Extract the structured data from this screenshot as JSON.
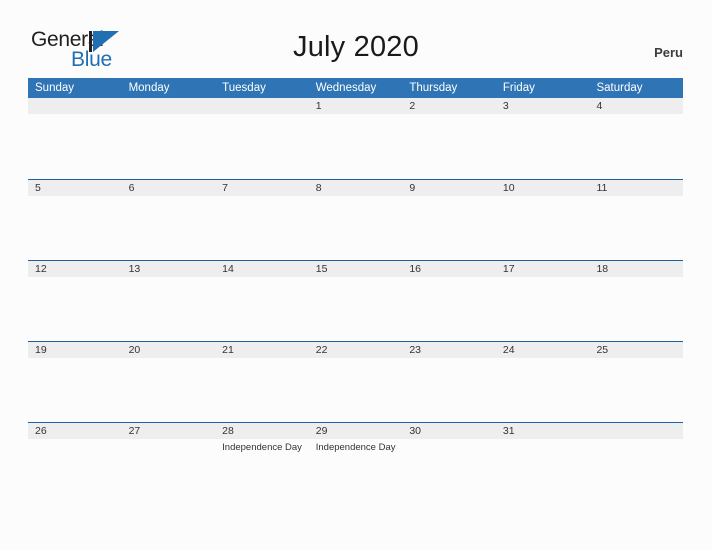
{
  "header": {
    "logo": {
      "word_one": "General",
      "word_two": "Blue",
      "mark_icon": "triangle-logo-icon"
    },
    "title": "July 2020",
    "locale": "Peru"
  },
  "calendar": {
    "weekdays": [
      "Sunday",
      "Monday",
      "Tuesday",
      "Wednesday",
      "Thursday",
      "Friday",
      "Saturday"
    ],
    "colors": {
      "header_blue": "#2f74b5",
      "separator_blue": "#1f5fa0",
      "date_band_gray": "#eeeeee",
      "page_background": "#fcfcfc",
      "brand_blue": "#1f6fb2"
    },
    "weeks": [
      {
        "days": [
          {
            "date": "",
            "event": ""
          },
          {
            "date": "",
            "event": ""
          },
          {
            "date": "",
            "event": ""
          },
          {
            "date": "1",
            "event": ""
          },
          {
            "date": "2",
            "event": ""
          },
          {
            "date": "3",
            "event": ""
          },
          {
            "date": "4",
            "event": ""
          }
        ]
      },
      {
        "days": [
          {
            "date": "5",
            "event": ""
          },
          {
            "date": "6",
            "event": ""
          },
          {
            "date": "7",
            "event": ""
          },
          {
            "date": "8",
            "event": ""
          },
          {
            "date": "9",
            "event": ""
          },
          {
            "date": "10",
            "event": ""
          },
          {
            "date": "11",
            "event": ""
          }
        ]
      },
      {
        "days": [
          {
            "date": "12",
            "event": ""
          },
          {
            "date": "13",
            "event": ""
          },
          {
            "date": "14",
            "event": ""
          },
          {
            "date": "15",
            "event": ""
          },
          {
            "date": "16",
            "event": ""
          },
          {
            "date": "17",
            "event": ""
          },
          {
            "date": "18",
            "event": ""
          }
        ]
      },
      {
        "days": [
          {
            "date": "19",
            "event": ""
          },
          {
            "date": "20",
            "event": ""
          },
          {
            "date": "21",
            "event": ""
          },
          {
            "date": "22",
            "event": ""
          },
          {
            "date": "23",
            "event": ""
          },
          {
            "date": "24",
            "event": ""
          },
          {
            "date": "25",
            "event": ""
          }
        ]
      },
      {
        "days": [
          {
            "date": "26",
            "event": ""
          },
          {
            "date": "27",
            "event": ""
          },
          {
            "date": "28",
            "event": "Independence Day"
          },
          {
            "date": "29",
            "event": "Independence Day"
          },
          {
            "date": "30",
            "event": ""
          },
          {
            "date": "31",
            "event": ""
          },
          {
            "date": "",
            "event": ""
          }
        ]
      }
    ]
  }
}
